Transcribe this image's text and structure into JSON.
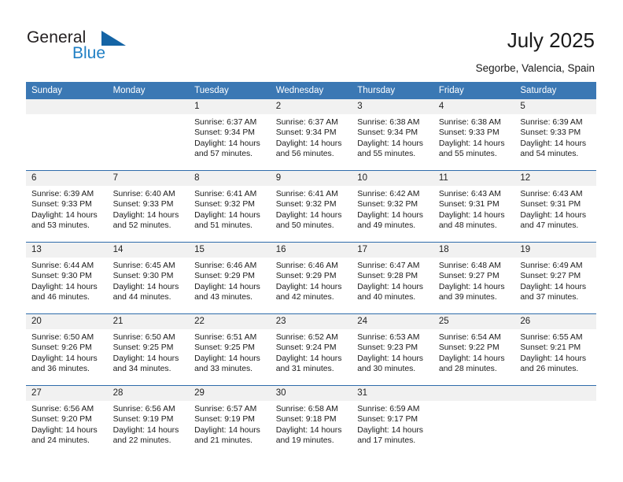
{
  "brand": {
    "name_top": "General",
    "name_bottom": "Blue"
  },
  "header": {
    "title": "July 2025",
    "location": "Segorbe, Valencia, Spain"
  },
  "calendar": {
    "weekdays": [
      "Sunday",
      "Monday",
      "Tuesday",
      "Wednesday",
      "Thursday",
      "Friday",
      "Saturday"
    ],
    "accent_color": "#3b78b4",
    "row_line_color": "#2f6cab",
    "daynum_band_color": "#f1f1f1",
    "weeks": [
      [
        {
          "day": "",
          "sunrise": "",
          "sunset": "",
          "daylight": ""
        },
        {
          "day": "",
          "sunrise": "",
          "sunset": "",
          "daylight": ""
        },
        {
          "day": "1",
          "sunrise": "Sunrise: 6:37 AM",
          "sunset": "Sunset: 9:34 PM",
          "daylight": "Daylight: 14 hours and 57 minutes."
        },
        {
          "day": "2",
          "sunrise": "Sunrise: 6:37 AM",
          "sunset": "Sunset: 9:34 PM",
          "daylight": "Daylight: 14 hours and 56 minutes."
        },
        {
          "day": "3",
          "sunrise": "Sunrise: 6:38 AM",
          "sunset": "Sunset: 9:34 PM",
          "daylight": "Daylight: 14 hours and 55 minutes."
        },
        {
          "day": "4",
          "sunrise": "Sunrise: 6:38 AM",
          "sunset": "Sunset: 9:33 PM",
          "daylight": "Daylight: 14 hours and 55 minutes."
        },
        {
          "day": "5",
          "sunrise": "Sunrise: 6:39 AM",
          "sunset": "Sunset: 9:33 PM",
          "daylight": "Daylight: 14 hours and 54 minutes."
        }
      ],
      [
        {
          "day": "6",
          "sunrise": "Sunrise: 6:39 AM",
          "sunset": "Sunset: 9:33 PM",
          "daylight": "Daylight: 14 hours and 53 minutes."
        },
        {
          "day": "7",
          "sunrise": "Sunrise: 6:40 AM",
          "sunset": "Sunset: 9:33 PM",
          "daylight": "Daylight: 14 hours and 52 minutes."
        },
        {
          "day": "8",
          "sunrise": "Sunrise: 6:41 AM",
          "sunset": "Sunset: 9:32 PM",
          "daylight": "Daylight: 14 hours and 51 minutes."
        },
        {
          "day": "9",
          "sunrise": "Sunrise: 6:41 AM",
          "sunset": "Sunset: 9:32 PM",
          "daylight": "Daylight: 14 hours and 50 minutes."
        },
        {
          "day": "10",
          "sunrise": "Sunrise: 6:42 AM",
          "sunset": "Sunset: 9:32 PM",
          "daylight": "Daylight: 14 hours and 49 minutes."
        },
        {
          "day": "11",
          "sunrise": "Sunrise: 6:43 AM",
          "sunset": "Sunset: 9:31 PM",
          "daylight": "Daylight: 14 hours and 48 minutes."
        },
        {
          "day": "12",
          "sunrise": "Sunrise: 6:43 AM",
          "sunset": "Sunset: 9:31 PM",
          "daylight": "Daylight: 14 hours and 47 minutes."
        }
      ],
      [
        {
          "day": "13",
          "sunrise": "Sunrise: 6:44 AM",
          "sunset": "Sunset: 9:30 PM",
          "daylight": "Daylight: 14 hours and 46 minutes."
        },
        {
          "day": "14",
          "sunrise": "Sunrise: 6:45 AM",
          "sunset": "Sunset: 9:30 PM",
          "daylight": "Daylight: 14 hours and 44 minutes."
        },
        {
          "day": "15",
          "sunrise": "Sunrise: 6:46 AM",
          "sunset": "Sunset: 9:29 PM",
          "daylight": "Daylight: 14 hours and 43 minutes."
        },
        {
          "day": "16",
          "sunrise": "Sunrise: 6:46 AM",
          "sunset": "Sunset: 9:29 PM",
          "daylight": "Daylight: 14 hours and 42 minutes."
        },
        {
          "day": "17",
          "sunrise": "Sunrise: 6:47 AM",
          "sunset": "Sunset: 9:28 PM",
          "daylight": "Daylight: 14 hours and 40 minutes."
        },
        {
          "day": "18",
          "sunrise": "Sunrise: 6:48 AM",
          "sunset": "Sunset: 9:27 PM",
          "daylight": "Daylight: 14 hours and 39 minutes."
        },
        {
          "day": "19",
          "sunrise": "Sunrise: 6:49 AM",
          "sunset": "Sunset: 9:27 PM",
          "daylight": "Daylight: 14 hours and 37 minutes."
        }
      ],
      [
        {
          "day": "20",
          "sunrise": "Sunrise: 6:50 AM",
          "sunset": "Sunset: 9:26 PM",
          "daylight": "Daylight: 14 hours and 36 minutes."
        },
        {
          "day": "21",
          "sunrise": "Sunrise: 6:50 AM",
          "sunset": "Sunset: 9:25 PM",
          "daylight": "Daylight: 14 hours and 34 minutes."
        },
        {
          "day": "22",
          "sunrise": "Sunrise: 6:51 AM",
          "sunset": "Sunset: 9:25 PM",
          "daylight": "Daylight: 14 hours and 33 minutes."
        },
        {
          "day": "23",
          "sunrise": "Sunrise: 6:52 AM",
          "sunset": "Sunset: 9:24 PM",
          "daylight": "Daylight: 14 hours and 31 minutes."
        },
        {
          "day": "24",
          "sunrise": "Sunrise: 6:53 AM",
          "sunset": "Sunset: 9:23 PM",
          "daylight": "Daylight: 14 hours and 30 minutes."
        },
        {
          "day": "25",
          "sunrise": "Sunrise: 6:54 AM",
          "sunset": "Sunset: 9:22 PM",
          "daylight": "Daylight: 14 hours and 28 minutes."
        },
        {
          "day": "26",
          "sunrise": "Sunrise: 6:55 AM",
          "sunset": "Sunset: 9:21 PM",
          "daylight": "Daylight: 14 hours and 26 minutes."
        }
      ],
      [
        {
          "day": "27",
          "sunrise": "Sunrise: 6:56 AM",
          "sunset": "Sunset: 9:20 PM",
          "daylight": "Daylight: 14 hours and 24 minutes."
        },
        {
          "day": "28",
          "sunrise": "Sunrise: 6:56 AM",
          "sunset": "Sunset: 9:19 PM",
          "daylight": "Daylight: 14 hours and 22 minutes."
        },
        {
          "day": "29",
          "sunrise": "Sunrise: 6:57 AM",
          "sunset": "Sunset: 9:19 PM",
          "daylight": "Daylight: 14 hours and 21 minutes."
        },
        {
          "day": "30",
          "sunrise": "Sunrise: 6:58 AM",
          "sunset": "Sunset: 9:18 PM",
          "daylight": "Daylight: 14 hours and 19 minutes."
        },
        {
          "day": "31",
          "sunrise": "Sunrise: 6:59 AM",
          "sunset": "Sunset: 9:17 PM",
          "daylight": "Daylight: 14 hours and 17 minutes."
        },
        {
          "day": "",
          "sunrise": "",
          "sunset": "",
          "daylight": ""
        },
        {
          "day": "",
          "sunrise": "",
          "sunset": "",
          "daylight": ""
        }
      ]
    ]
  }
}
